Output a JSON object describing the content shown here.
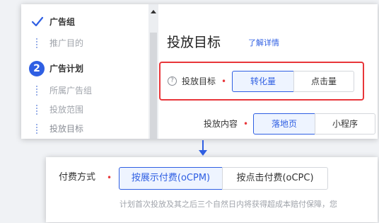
{
  "sidebar": {
    "items": [
      {
        "label": "广告组",
        "state": "done"
      },
      {
        "label": "推广目的",
        "state": "sub"
      },
      {
        "label": "广告计划",
        "state": "active",
        "number": "2"
      },
      {
        "label": "所属广告组",
        "state": "sub"
      },
      {
        "label": "投放范围",
        "state": "sub"
      },
      {
        "label": "投放目标",
        "state": "sub"
      }
    ]
  },
  "panel": {
    "title": "投放目标",
    "link": "了解详情",
    "rows": [
      {
        "label": "投放目标",
        "options": [
          "转化量",
          "点击量"
        ],
        "selected": 0,
        "help_icon": "question-circle-icon"
      },
      {
        "label": "投放内容",
        "options": [
          "落地页",
          "小程序"
        ],
        "selected": 0
      }
    ]
  },
  "billing": {
    "label": "付费方式",
    "options": [
      "按展示付费(oCPM)",
      "按点击付费(oCPC)"
    ],
    "selected": 0,
    "note": "计划首次投放及其之后三个自然日内将获得超成本赔付保障，您"
  },
  "colors": {
    "accent": "#2f5fe3",
    "highlight": "#e8363a",
    "required": "#e8363a"
  }
}
